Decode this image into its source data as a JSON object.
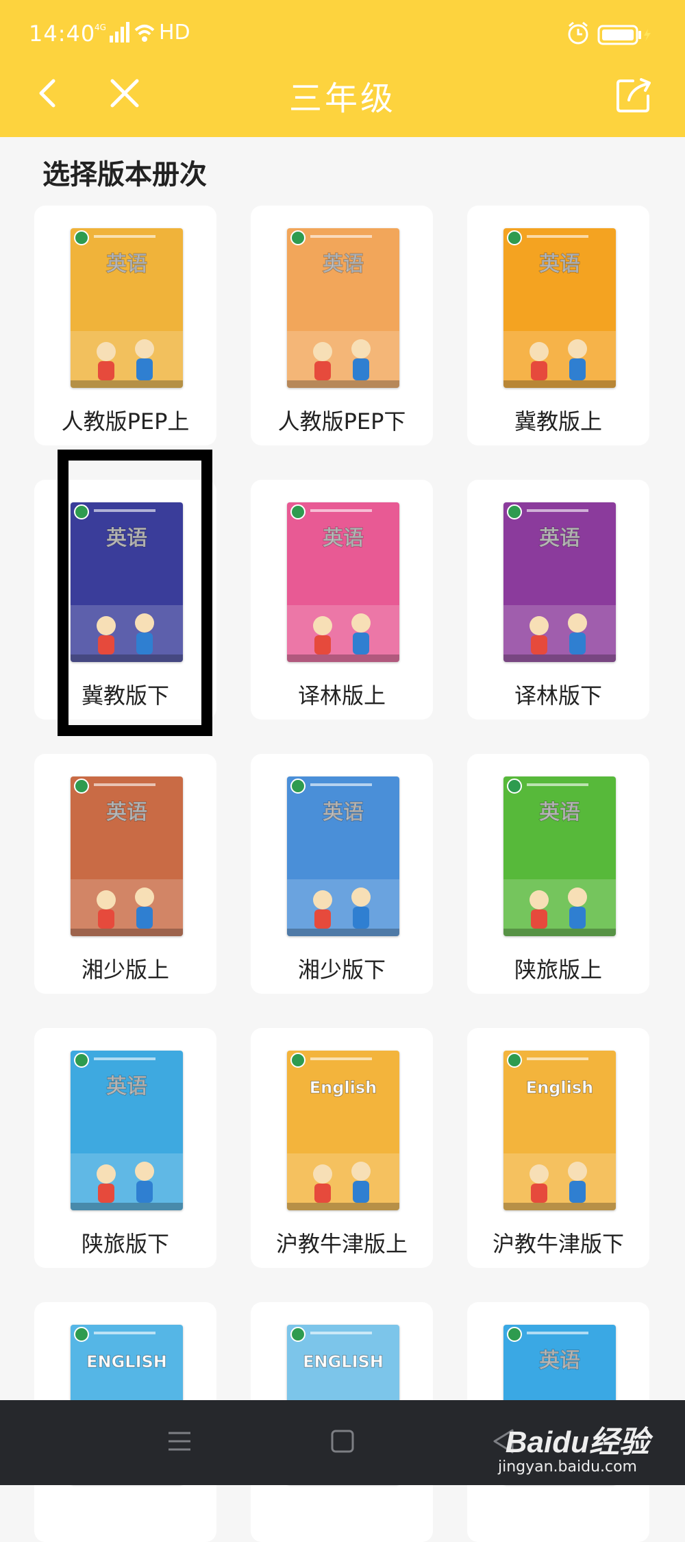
{
  "status_bar": {
    "time": "14:40",
    "network": "4G",
    "hd": "HD"
  },
  "header": {
    "title": "三年级"
  },
  "section": {
    "title": "选择版本册次"
  },
  "books": [
    {
      "label": "人教版PEP上",
      "cover_title": "英语",
      "color": "#f0b33a"
    },
    {
      "label": "人教版PEP下",
      "cover_title": "英语",
      "color": "#f2a65a"
    },
    {
      "label": "冀教版上",
      "cover_title": "英语",
      "color": "#f4a321"
    },
    {
      "label": "冀教版下",
      "cover_title": "英语",
      "color": "#3a3d9a"
    },
    {
      "label": "译林版上",
      "cover_title": "英语",
      "color": "#e85a94"
    },
    {
      "label": "译林版下",
      "cover_title": "英语",
      "color": "#8b3b9c"
    },
    {
      "label": "湘少版上",
      "cover_title": "英语",
      "color": "#c96b45"
    },
    {
      "label": "湘少版下",
      "cover_title": "英语",
      "color": "#4a8fd8"
    },
    {
      "label": "陕旅版上",
      "cover_title": "英语",
      "color": "#57b93a"
    },
    {
      "label": "陕旅版下",
      "cover_title": "英语",
      "color": "#3ea9e0"
    },
    {
      "label": "沪教牛津版上",
      "cover_title": "English",
      "color": "#f3b43c"
    },
    {
      "label": "沪教牛津版下",
      "cover_title": "English",
      "color": "#f3b43c"
    },
    {
      "label": "",
      "cover_title": "ENGLISH",
      "color": "#55b6e6"
    },
    {
      "label": "",
      "cover_title": "ENGLISH",
      "color": "#7cc5ea"
    },
    {
      "label": "",
      "cover_title": "英语",
      "color": "#3aa8e4"
    }
  ],
  "watermark": {
    "brand": "Baidu经验",
    "url": "jingyan.baidu.com"
  },
  "colors": {
    "header_bg": "#fdd33e",
    "page_bg": "#f6f6f6",
    "navbar_bg": "#26282c"
  },
  "icons": [
    "back-arrow-icon",
    "close-icon",
    "share-icon",
    "menu-icon",
    "home-icon",
    "back-triangle-icon"
  ]
}
